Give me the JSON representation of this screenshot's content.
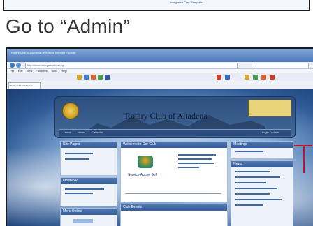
{
  "top": {
    "link_text": "Integrated Crisp Template"
  },
  "heading": "Go to “Admin”",
  "browser": {
    "title": "Rotary Club of Altadena - Windows Internet Explorer",
    "url": "http://www.rotaryaltadena.org/",
    "menu": [
      "File",
      "Edit",
      "View",
      "Favorites",
      "Tools",
      "Help"
    ],
    "tab_label": "Rotary Club of Altadena"
  },
  "site": {
    "name": "Rotary Club of Altadena",
    "nav": [
      "Home",
      "News",
      "Calendar"
    ],
    "nav_right": "Login | Admin",
    "sidebar": [
      "Site Pages",
      "Download",
      "More Online"
    ],
    "welcome": "Welcome to Our Club",
    "slogan": "Service Above Self",
    "club_events": "Club Events",
    "right_sidebar": [
      "Meetings",
      "News"
    ]
  },
  "colors": {
    "accent": "#c0102a",
    "banner": "#2e4f7f"
  }
}
